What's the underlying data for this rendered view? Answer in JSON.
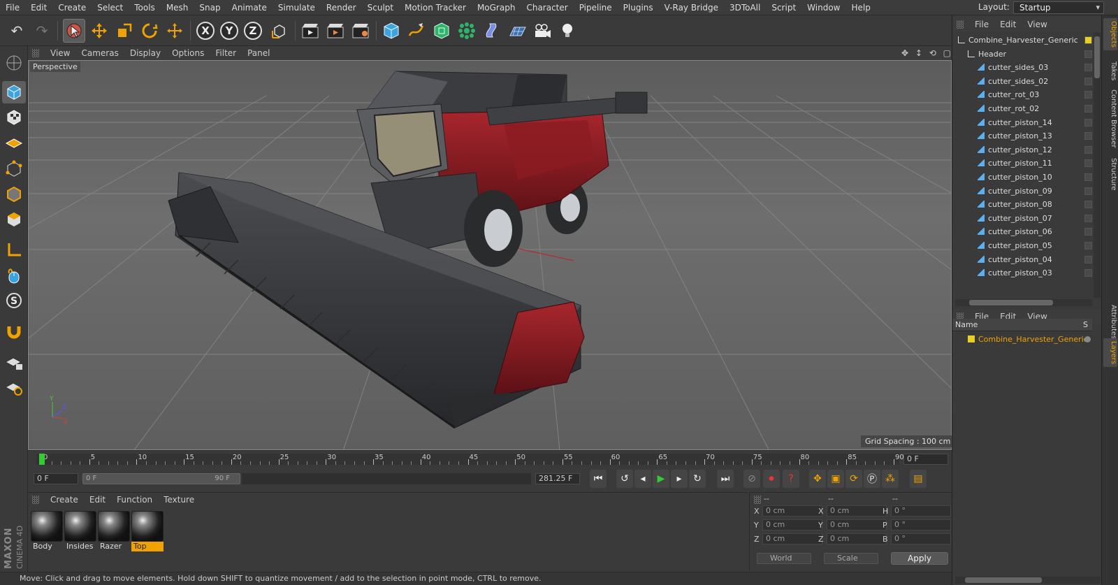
{
  "menubar": {
    "items": [
      "File",
      "Edit",
      "Create",
      "Select",
      "Tools",
      "Mesh",
      "Snap",
      "Animate",
      "Simulate",
      "Render",
      "Sculpt",
      "Motion Tracker",
      "MoGraph",
      "Character",
      "Pipeline",
      "Plugins",
      "V-Ray Bridge",
      "3DToAll",
      "Script",
      "Window",
      "Help"
    ],
    "layout_label": "Layout:",
    "layout_value": "Startup"
  },
  "toolbar": {
    "axis_x": "X",
    "axis_y": "Y",
    "axis_z": "Z"
  },
  "viewport": {
    "menu": [
      "View",
      "Cameras",
      "Display",
      "Options",
      "Filter",
      "Panel"
    ],
    "camera_label": "Perspective",
    "grid_spacing": "Grid Spacing : 100 cm"
  },
  "timeline": {
    "ticks": [
      "0",
      "5",
      "10",
      "15",
      "20",
      "25",
      "30",
      "35",
      "40",
      "45",
      "50",
      "55",
      "60",
      "65",
      "70",
      "75",
      "80",
      "85",
      "90"
    ],
    "current_frame_right": "0 F",
    "start_field": "0 F",
    "range_start": "0 F",
    "range_end": "90 F",
    "fps_field": "281.25 F"
  },
  "material_manager": {
    "menu": [
      "Create",
      "Edit",
      "Function",
      "Texture"
    ],
    "materials": [
      {
        "name": "Body"
      },
      {
        "name": "Insides"
      },
      {
        "name": "Razer"
      },
      {
        "name": "Top"
      }
    ]
  },
  "coordinates": {
    "header_a": "--",
    "header_b": "--",
    "header_c": "--",
    "rows": [
      {
        "a": "X",
        "av": "0 cm",
        "b": "X",
        "bv": "0 cm",
        "c": "H",
        "cv": "0 °"
      },
      {
        "a": "Y",
        "av": "0 cm",
        "b": "Y",
        "bv": "0 cm",
        "c": "P",
        "cv": "0 °"
      },
      {
        "a": "Z",
        "av": "0 cm",
        "b": "Z",
        "bv": "0 cm",
        "c": "B",
        "cv": "0 °"
      }
    ],
    "mode_world": "World",
    "mode_scale": "Scale",
    "apply": "Apply"
  },
  "status_text": "Move: Click and drag to move elements. Hold down SHIFT to quantize movement / add to the selection in point mode, CTRL to remove.",
  "objects_panel": {
    "menu": [
      "File",
      "Edit",
      "View"
    ],
    "items": [
      {
        "name": "Combine_Harvester_Generic",
        "level": 0
      },
      {
        "name": "Header",
        "level": 1
      },
      {
        "name": "cutter_sides_03",
        "level": 2
      },
      {
        "name": "cutter_sides_02",
        "level": 2
      },
      {
        "name": "cutter_rot_03",
        "level": 2
      },
      {
        "name": "cutter_rot_02",
        "level": 2
      },
      {
        "name": "cutter_piston_14",
        "level": 2
      },
      {
        "name": "cutter_piston_13",
        "level": 2
      },
      {
        "name": "cutter_piston_12",
        "level": 2
      },
      {
        "name": "cutter_piston_11",
        "level": 2
      },
      {
        "name": "cutter_piston_10",
        "level": 2
      },
      {
        "name": "cutter_piston_09",
        "level": 2
      },
      {
        "name": "cutter_piston_08",
        "level": 2
      },
      {
        "name": "cutter_piston_07",
        "level": 2
      },
      {
        "name": "cutter_piston_06",
        "level": 2
      },
      {
        "name": "cutter_piston_05",
        "level": 2
      },
      {
        "name": "cutter_piston_04",
        "level": 2
      },
      {
        "name": "cutter_piston_03",
        "level": 2
      }
    ]
  },
  "layers_panel": {
    "menu": [
      "File",
      "Edit",
      "View"
    ],
    "col_name": "Name",
    "col_s": "S",
    "layer": "Combine_Harvester_Generic"
  },
  "side_tabs": [
    "Objects",
    "Takes",
    "Content Browser",
    "Structure",
    "Attributes",
    "Layers"
  ],
  "branding": "MAXON CINEMA 4D",
  "colors": {
    "accent": "#f0a300",
    "harvester_red": "#8a1f24"
  }
}
